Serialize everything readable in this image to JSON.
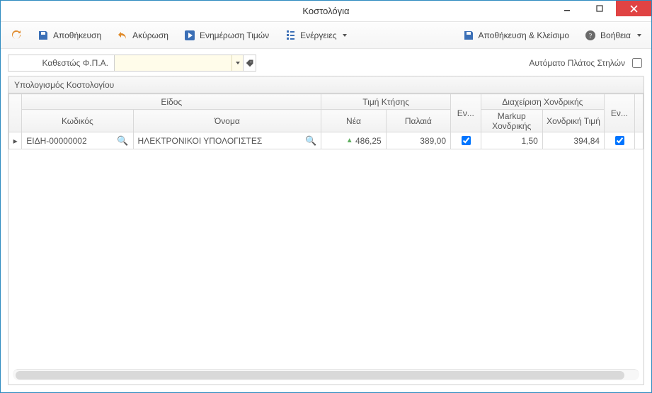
{
  "window": {
    "title": "Κοστολόγια"
  },
  "toolbar": {
    "refresh": "",
    "save": "Αποθήκευση",
    "cancel": "Ακύρωση",
    "update_prices": "Ενημέρωση Τιμών",
    "actions": "Ενέργειες",
    "save_close": "Αποθήκευση & Κλείσιμο",
    "help": "Βοήθεια"
  },
  "filters": {
    "vat_label": "Καθεστώς Φ.Π.Α.",
    "vat_value": "",
    "auto_width_label": "Αυτόματο Πλάτος Στηλών",
    "auto_width_checked": false
  },
  "panel": {
    "title": "Υπολογισμός Κοστολογίου"
  },
  "columns": {
    "group_item": "Είδος",
    "group_acq": "Τιμή Κτήσης",
    "group_wholesale": "Διαχείριση Χονδρικής",
    "code": "Κωδικός",
    "name": "Όνομα",
    "new": "Νέα",
    "old": "Παλαιά",
    "en1": "Εν...",
    "markup": "Markup Χονδρικής",
    "wholesale_price": "Χονδρική Τιμή",
    "en2": "Εν..."
  },
  "rows": [
    {
      "code": "ΕΙΔΗ-00000002",
      "name": "ΗΛΕΚΤΡΟΝΙΚΟΙ ΥΠΟΛΟΓΙΣΤΕΣ",
      "new": "486,25",
      "old": "389,00",
      "en1": true,
      "markup": "1,50",
      "wholesale_price": "394,84",
      "en2": true
    }
  ]
}
